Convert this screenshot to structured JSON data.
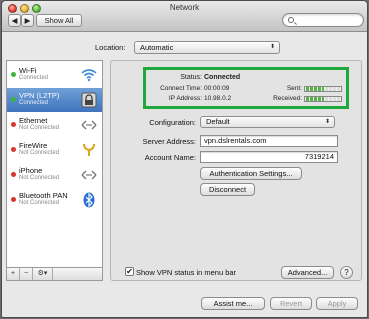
{
  "window": {
    "title": "Network"
  },
  "toolbar": {
    "show_all": "Show All",
    "back": "◀",
    "forward": "▶",
    "search_placeholder": ""
  },
  "location": {
    "label": "Location:",
    "value": "Automatic"
  },
  "services": [
    {
      "name": "Wi-Fi",
      "status": "Connected",
      "dot": "green",
      "icon": "wifi-icon"
    },
    {
      "name": "VPN (L2TP)",
      "status": "Connected",
      "dot": "green",
      "icon": "lock-icon",
      "selected": true
    },
    {
      "name": "Ethernet",
      "status": "Not Connected",
      "dot": "red",
      "icon": "ethernet-icon"
    },
    {
      "name": "FireWire",
      "status": "Not Connected",
      "dot": "red",
      "icon": "firewire-icon"
    },
    {
      "name": "iPhone",
      "status": "Not Connected",
      "dot": "red",
      "icon": "iphone-icon"
    },
    {
      "name": "Bluetooth PAN",
      "status": "Not Connected",
      "dot": "red",
      "icon": "bluetooth-icon"
    }
  ],
  "sidebar_tools": {
    "add": "+",
    "remove": "−",
    "action": "⚙▾"
  },
  "status": {
    "status_label": "Status:",
    "status_value": "Connected",
    "connect_time_label": "Connect Time:",
    "connect_time_value": "00:00:09",
    "ip_label": "IP Address:",
    "ip_value": "10.98.0.2",
    "sent_label": "Sent:",
    "received_label": "Received:",
    "highlight_color": "#1fa83c"
  },
  "config": {
    "configuration_label": "Configuration:",
    "configuration_value": "Default",
    "server_label": "Server Address:",
    "server_value": "vpn.dslrentals.com",
    "account_label": "Account Name:",
    "account_value": "7319214",
    "auth_button": "Authentication Settings...",
    "disconnect_button": "Disconnect"
  },
  "footer": {
    "show_vpn_checkbox": "✔",
    "show_vpn_label": "Show VPN status in menu bar",
    "advanced_button": "Advanced...",
    "help": "?",
    "assist_button": "Assist me...",
    "revert_button": "Revert",
    "apply_button": "Apply"
  }
}
